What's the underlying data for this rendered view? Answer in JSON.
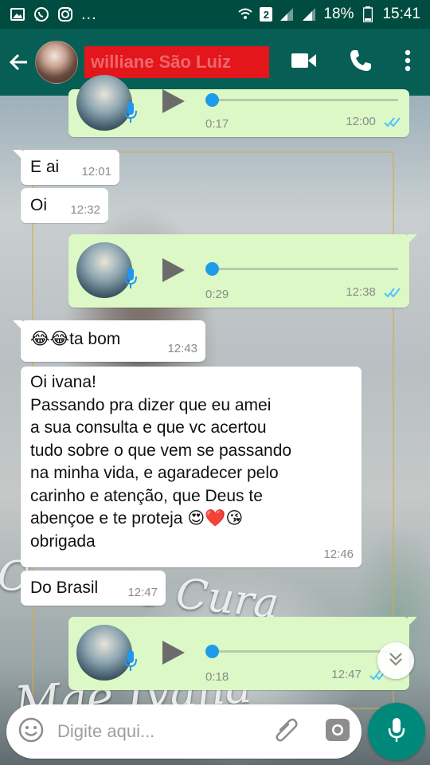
{
  "status_bar": {
    "sim_badge": "2",
    "battery": "18%",
    "time": "15:41"
  },
  "header": {
    "contact_name": "williane São Luiz"
  },
  "messages": [
    {
      "type": "voice",
      "direction": "out",
      "duration": "0:17",
      "time": "12:00",
      "status": "read"
    },
    {
      "type": "text",
      "direction": "in",
      "text": "E ai",
      "time": "12:01"
    },
    {
      "type": "text",
      "direction": "in",
      "text": "Oi",
      "time": "12:32"
    },
    {
      "type": "voice",
      "direction": "out",
      "duration": "0:29",
      "time": "12:38",
      "status": "read"
    },
    {
      "type": "text",
      "direction": "in",
      "text": "😂😂ta bom",
      "time": "12:43"
    },
    {
      "type": "text",
      "direction": "in",
      "lines": [
        "Oi ivana!",
        "Passando pra dizer que eu amei",
        "a sua consulta e que vc acertou",
        "tudo sobre o que vem se passando",
        "na minha vida, e agaradecer pelo",
        "carinho e atenção, que Deus te",
        "abençoe e te proteja 😍❤️😘",
        "obrigada"
      ],
      "time": "12:46"
    },
    {
      "type": "text",
      "direction": "in",
      "text": "Do Brasil",
      "time": "12:47"
    },
    {
      "type": "voice",
      "direction": "out",
      "duration": "0:18",
      "time": "12:47",
      "status": "read"
    }
  ],
  "wallpaper_text": {
    "line1": "Casa de Cura",
    "line2": "Mãe Ivana"
  },
  "input": {
    "placeholder": "Digite aqui..."
  },
  "colors": {
    "status_bar": "#004c40",
    "app_bar": "#075e54",
    "outgoing_bubble": "#dcf8c6",
    "incoming_bubble": "#ffffff",
    "read_ticks": "#4fc3f7",
    "play_knob": "#1e9be8",
    "fab": "#00897b",
    "name_redaction": "#e3161b"
  },
  "icons": [
    "whatsapp-icon",
    "instagram-icon",
    "wifi-icon",
    "signal-icon",
    "battery-icon",
    "back-arrow-icon",
    "video-call-icon",
    "phone-icon",
    "more-vert-icon",
    "mic-icon",
    "play-icon",
    "double-check-icon",
    "chevron-double-down-icon",
    "emoji-icon",
    "attach-icon",
    "camera-icon"
  ]
}
